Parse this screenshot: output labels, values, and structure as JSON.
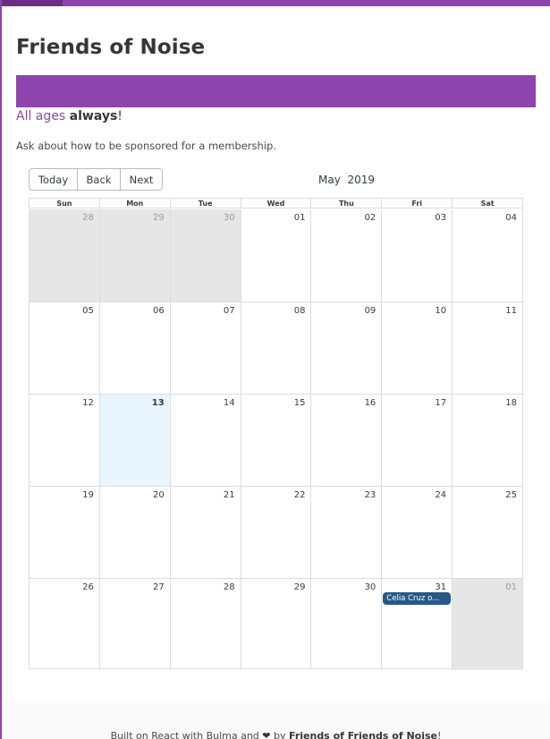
{
  "header": {
    "title": "Friends of Noise",
    "tagline_pre": "All ages ",
    "tagline_strong": "always",
    "tagline_post": "!",
    "subtext": "Ask about how to be sponsored for a membership."
  },
  "colors": {
    "brand": "#8e44ad",
    "event": "#265985",
    "today": "#eaf6ff",
    "off_range": "#e6e6e6"
  },
  "calendar": {
    "toolbar": {
      "today_label": "Today",
      "back_label": "Back",
      "next_label": "Next"
    },
    "month_label": "May  2019",
    "weekdays": [
      "Sun",
      "Mon",
      "Tue",
      "Wed",
      "Thu",
      "Fri",
      "Sat"
    ],
    "weeks": [
      [
        "28",
        "29",
        "30",
        "01",
        "02",
        "03",
        "04"
      ],
      [
        "05",
        "06",
        "07",
        "08",
        "09",
        "10",
        "11"
      ],
      [
        "12",
        "13",
        "14",
        "15",
        "16",
        "17",
        "18"
      ],
      [
        "19",
        "20",
        "21",
        "22",
        "23",
        "24",
        "25"
      ],
      [
        "26",
        "27",
        "28",
        "29",
        "30",
        "31",
        "01"
      ]
    ],
    "event": {
      "title": "Celia  Cruz  o..."
    }
  },
  "footer": {
    "text_pre": "Built on React with Bulma and ",
    "heart_icon": "heart-icon",
    "text_by": " by ",
    "org": "Friends of Friends of Noise",
    "text_post": "!"
  }
}
